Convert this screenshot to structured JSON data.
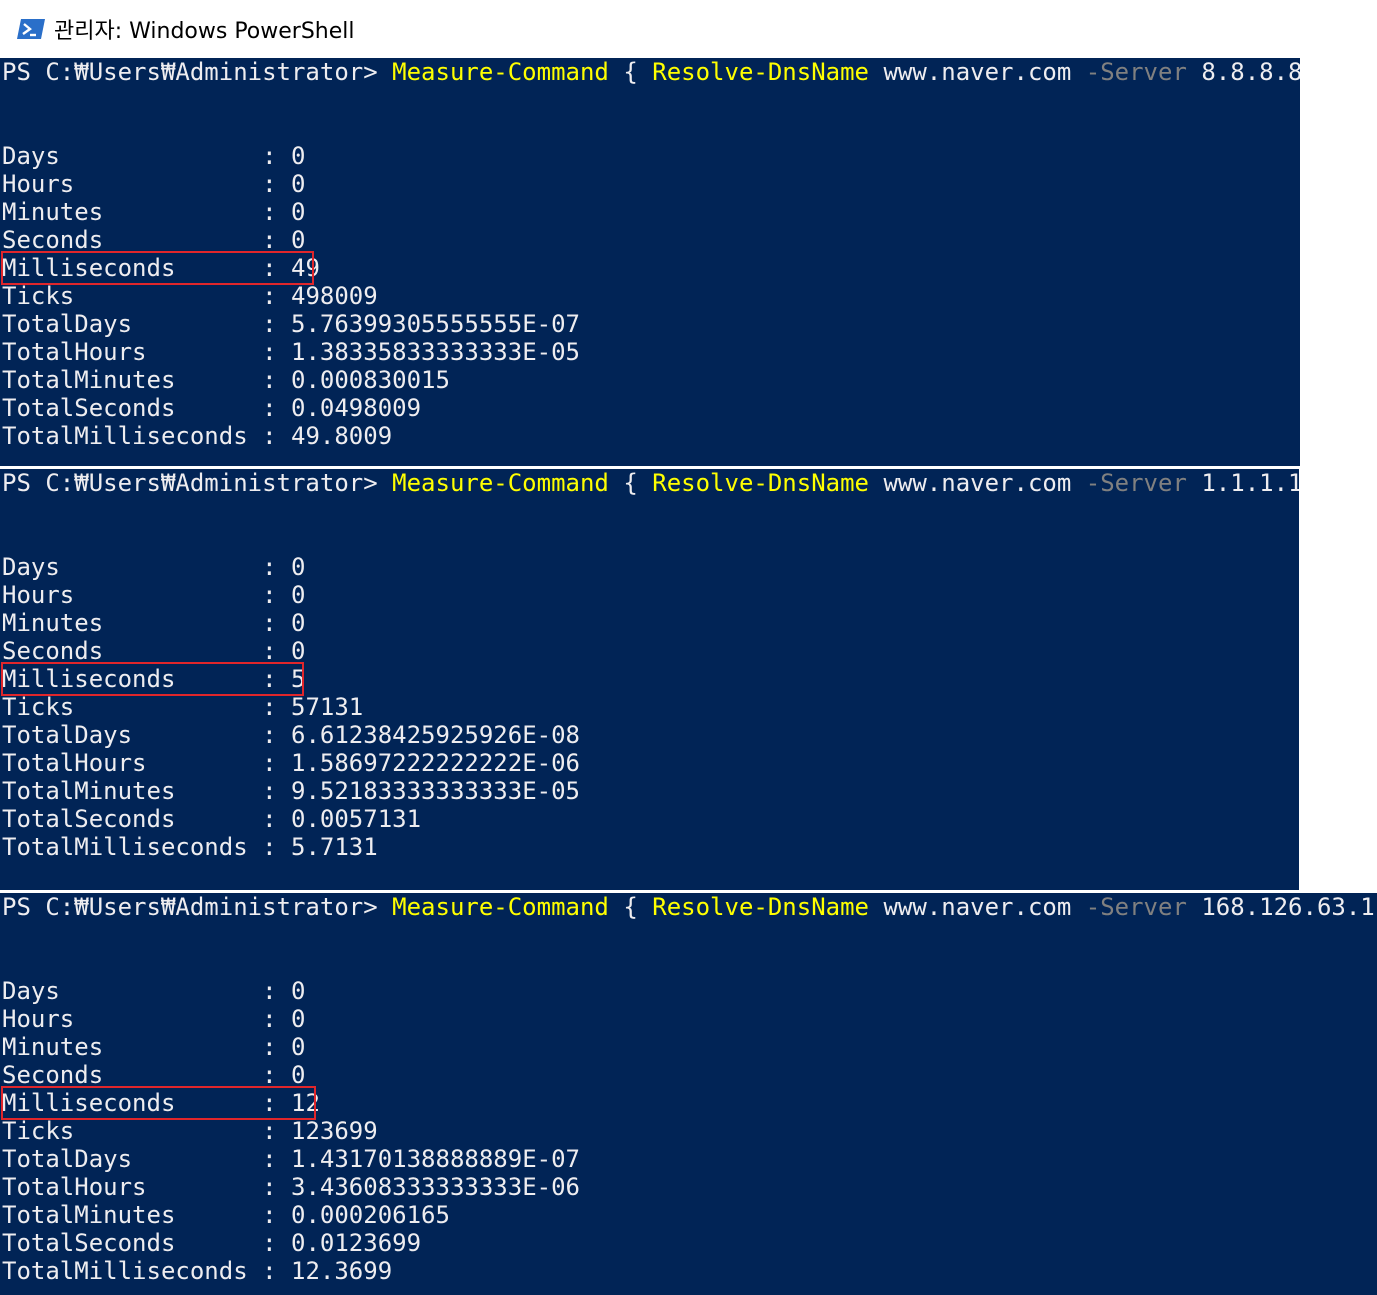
{
  "window": {
    "title": "관리자: Windows PowerShell",
    "icon": "powershell-icon"
  },
  "colors": {
    "console_bg": "#012456",
    "text": "#eeedf0",
    "command": "#ffff00",
    "parameter": "#808080",
    "highlight_box": "#e0262b",
    "cursor": "#fcd0a0"
  },
  "runs": [
    {
      "prompt": "PS C:₩Users₩Administrator> ",
      "cmd1": "Measure-Command",
      "brace_open": " { ",
      "cmd2": "Resolve-DnsName",
      "arg": " www.naver.com ",
      "param": "-Server",
      "server": " 8.8.8.8 ",
      "brace_close": "}",
      "rows": [
        {
          "label": "Days              ",
          "value": "0"
        },
        {
          "label": "Hours             ",
          "value": "0"
        },
        {
          "label": "Minutes           ",
          "value": "0"
        },
        {
          "label": "Seconds           ",
          "value": "0"
        },
        {
          "label": "Milliseconds      ",
          "value": "49"
        },
        {
          "label": "Ticks             ",
          "value": "498009"
        },
        {
          "label": "TotalDays         ",
          "value": "5.76399305555555E-07"
        },
        {
          "label": "TotalHours        ",
          "value": "1.38335833333333E-05"
        },
        {
          "label": "TotalMinutes      ",
          "value": "0.000830015"
        },
        {
          "label": "TotalSeconds      ",
          "value": "0.0498009"
        },
        {
          "label": "TotalMilliseconds ",
          "value": "49.8009"
        }
      ]
    },
    {
      "prompt": "PS C:₩Users₩Administrator> ",
      "cmd1": "Measure-Command",
      "brace_open": " { ",
      "cmd2": "Resolve-DnsName",
      "arg": " www.naver.com ",
      "param": "-Server",
      "server": " 1.1.1.1 ",
      "brace_close": "}",
      "rows": [
        {
          "label": "Days              ",
          "value": "0"
        },
        {
          "label": "Hours             ",
          "value": "0"
        },
        {
          "label": "Minutes           ",
          "value": "0"
        },
        {
          "label": "Seconds           ",
          "value": "0"
        },
        {
          "label": "Milliseconds      ",
          "value": "5"
        },
        {
          "label": "Ticks             ",
          "value": "57131"
        },
        {
          "label": "TotalDays         ",
          "value": "6.61238425925926E-08"
        },
        {
          "label": "TotalHours        ",
          "value": "1.58697222222222E-06"
        },
        {
          "label": "TotalMinutes      ",
          "value": "9.52183333333333E-05"
        },
        {
          "label": "TotalSeconds      ",
          "value": "0.0057131"
        },
        {
          "label": "TotalMilliseconds ",
          "value": "5.7131"
        }
      ]
    },
    {
      "prompt": "PS C:₩Users₩Administrator> ",
      "cmd1": "Measure-Command",
      "brace_open": " { ",
      "cmd2": "Resolve-DnsName",
      "arg": " www.naver.com ",
      "param": "-Server",
      "server": " 168.126.63.1 ",
      "brace_close": "}",
      "rows": [
        {
          "label": "Days              ",
          "value": "0"
        },
        {
          "label": "Hours             ",
          "value": "0"
        },
        {
          "label": "Minutes           ",
          "value": "0"
        },
        {
          "label": "Seconds           ",
          "value": "0"
        },
        {
          "label": "Milliseconds      ",
          "value": "12"
        },
        {
          "label": "Ticks             ",
          "value": "123699"
        },
        {
          "label": "TotalDays         ",
          "value": "1.43170138888889E-07"
        },
        {
          "label": "TotalHours        ",
          "value": "3.43608333333333E-06"
        },
        {
          "label": "TotalMinutes      ",
          "value": "0.000206165"
        },
        {
          "label": "TotalSeconds      ",
          "value": "0.0123699"
        },
        {
          "label": "TotalMilliseconds ",
          "value": "12.3699"
        }
      ]
    }
  ]
}
